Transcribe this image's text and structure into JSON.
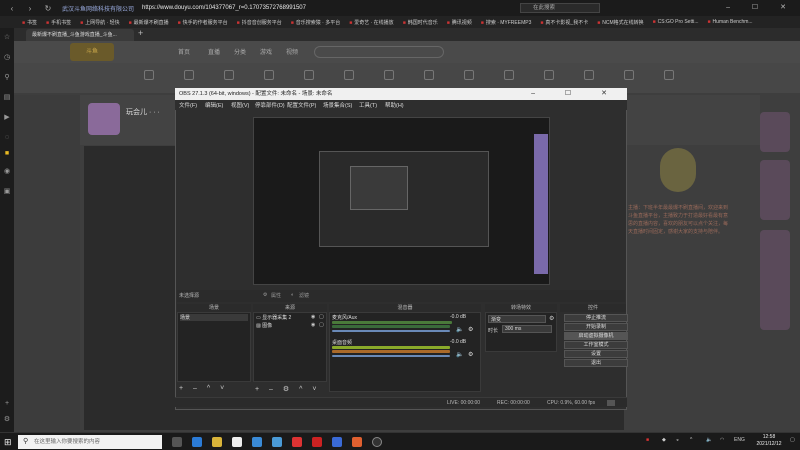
{
  "browser": {
    "site_name": "武汉斗鱼网络科技有限公司",
    "url": "https://www.douyu.com/104377067_r=0.17073572768991507",
    "search_placeholder": "在此搜索",
    "tab_title": "最新爆不刷直播_斗鱼游戏直播_斗鱼...",
    "bookmarks": [
      "书签",
      "手机书签",
      "上网导航 · 轻快",
      "最新爆不刷直播",
      "快手的作者服务平台",
      "抖音音创服务平台",
      "音乐搜索猿 · 多平台",
      "爱奇艺 · 在线播放",
      "韩国时代音乐",
      "腾讯视频",
      "搜索 · MYFREEMP3",
      "真不卡影视_我不卡",
      "NCM格式在线转换",
      "CS:GO Pro Setti...",
      "Human Benchm..."
    ]
  },
  "douyu": {
    "streamer_name": "玩会儿 · · ·",
    "nav_items": [
      "首页",
      "直播",
      "分类",
      "游戏",
      "视频"
    ],
    "right_text": "主播：下班半年最最爆不刷直播间，欢迎来到斗鱼直播平台，主播致力于打造最好看最有意思的直播内容，喜欢的朋友可以点个关注，每天直播时间固定，感谢大家的支持与陪伴。"
  },
  "obs": {
    "title": "OBS 27.1.3 (64-bit, windows) - 配置文件: 未命名 - 场景: 未命名",
    "menu": [
      "文件(F)",
      "编辑(E)",
      "视图(V)",
      "停靠部件(D)",
      "配置文件(P)",
      "场景集合(S)",
      "工具(T)",
      "帮助(H)"
    ],
    "source_toolbar_text": "未选择源",
    "properties_label": "属性",
    "filters_label": "滤镜",
    "docks": {
      "scenes": "场景",
      "sources": "来源",
      "mixer": "混音器",
      "transitions": "转场特效",
      "controls": "控件"
    },
    "scene_items": [
      "场景"
    ],
    "source_items": [
      "显示器采集 2",
      "图像"
    ],
    "mixer": {
      "track1_name": "麦克风/Aux",
      "track1_db": "-0.0 dB",
      "track2_name": "桌面音频",
      "track2_db": "-0.0 dB"
    },
    "transition": {
      "type": "渐变",
      "duration_label": "时长",
      "duration_value": "300 ms"
    },
    "controls": [
      "停止推流",
      "开始录制",
      "启动虚拟摄像机",
      "工作室模式",
      "设置",
      "退出"
    ],
    "status": {
      "live": "LIVE: 00:00:00",
      "rec": "REC: 00:00:00",
      "cpu": "CPU: 0.9%, 60.00 fps"
    }
  },
  "taskbar": {
    "search_placeholder": "在这里输入你要搜索的内容",
    "lang": "ENG",
    "time": "12:58",
    "date": "2021/12/12"
  }
}
